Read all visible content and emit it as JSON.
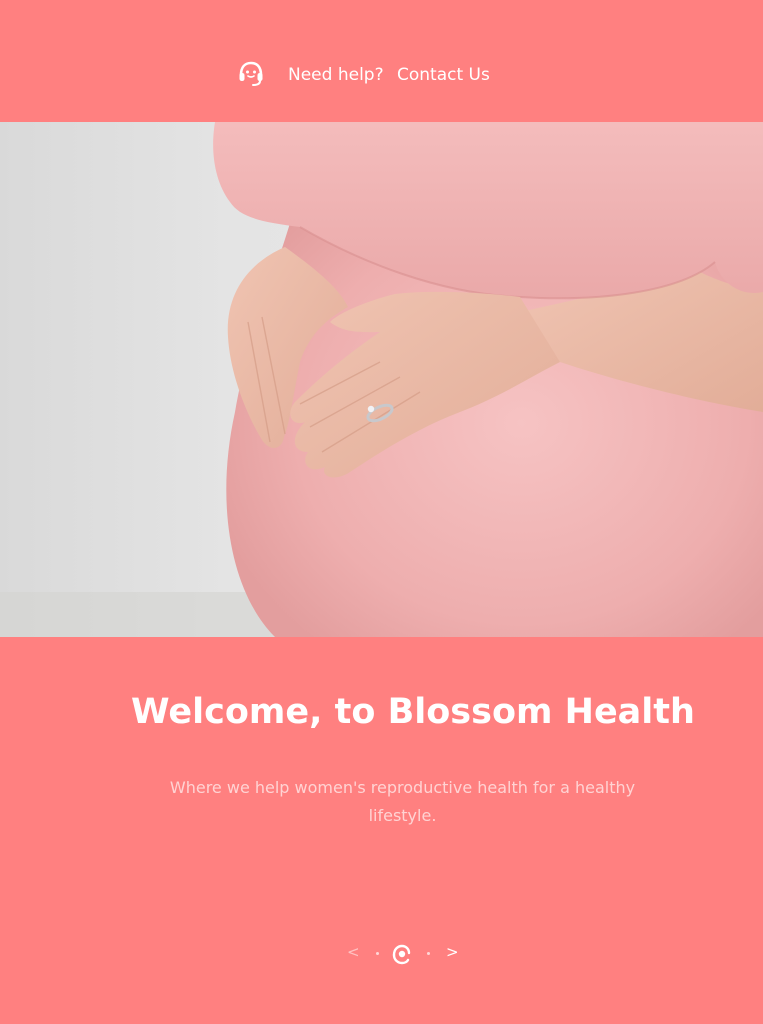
{
  "colors": {
    "brand_coral": "#ff8080",
    "text_white": "#ffffff",
    "subtitle_pink": "#ffd3d3",
    "dress_pink": "#f2b4b4",
    "skin": "#eab9a6"
  },
  "topbar": {
    "icon": "headset-support-icon",
    "help_text": "Need help?",
    "contact_label": "Contact Us"
  },
  "hero": {
    "image_description_icon": "pregnant-woman-photo"
  },
  "welcome": {
    "title": "Welcome, to Blossom Health",
    "subtitle": "Where we help women's reproductive health for a healthy lifestyle."
  },
  "slider": {
    "prev_label": "<",
    "next_label": ">",
    "slide_count": 3,
    "active_index": 2,
    "active_icon": "blossom-logo-icon"
  }
}
